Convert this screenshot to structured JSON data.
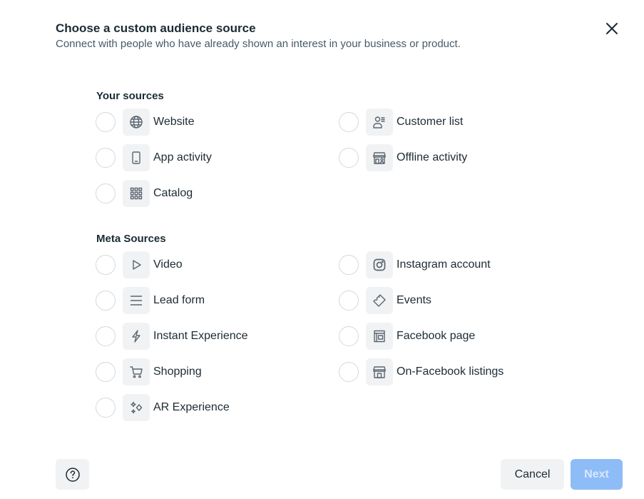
{
  "header": {
    "title": "Choose a custom audience source",
    "subtitle": "Connect with people who have already shown an interest in your business or product."
  },
  "sections": [
    {
      "title": "Your sources",
      "options": [
        {
          "label": "Website",
          "icon": "globe-icon",
          "selected": false
        },
        {
          "label": "Customer list",
          "icon": "customer-list-icon",
          "selected": false
        },
        {
          "label": "App activity",
          "icon": "mobile-phone-icon",
          "selected": false
        },
        {
          "label": "Offline activity",
          "icon": "storefront-person-icon",
          "selected": false
        },
        {
          "label": "Catalog",
          "icon": "grid-icon",
          "selected": false
        }
      ]
    },
    {
      "title": "Meta Sources",
      "options": [
        {
          "label": "Video",
          "icon": "play-icon",
          "selected": false
        },
        {
          "label": "Instagram account",
          "icon": "instagram-icon",
          "selected": false
        },
        {
          "label": "Lead form",
          "icon": "lines-icon",
          "selected": false
        },
        {
          "label": "Events",
          "icon": "ticket-icon",
          "selected": false
        },
        {
          "label": "Instant Experience",
          "icon": "lightning-icon",
          "selected": false
        },
        {
          "label": "Facebook page",
          "icon": "page-icon",
          "selected": false
        },
        {
          "label": "Shopping",
          "icon": "cart-icon",
          "selected": false
        },
        {
          "label": "On-Facebook listings",
          "icon": "storefront-icon",
          "selected": false
        },
        {
          "label": "AR Experience",
          "icon": "sparkle-icon",
          "selected": false
        }
      ]
    }
  ],
  "footer": {
    "help_icon": "question-circle-icon",
    "cancel_label": "Cancel",
    "next_label": "Next",
    "next_enabled": false
  },
  "colors": {
    "primary_disabled": "#8ebcf7",
    "neutral_button": "#f1f2f4"
  }
}
